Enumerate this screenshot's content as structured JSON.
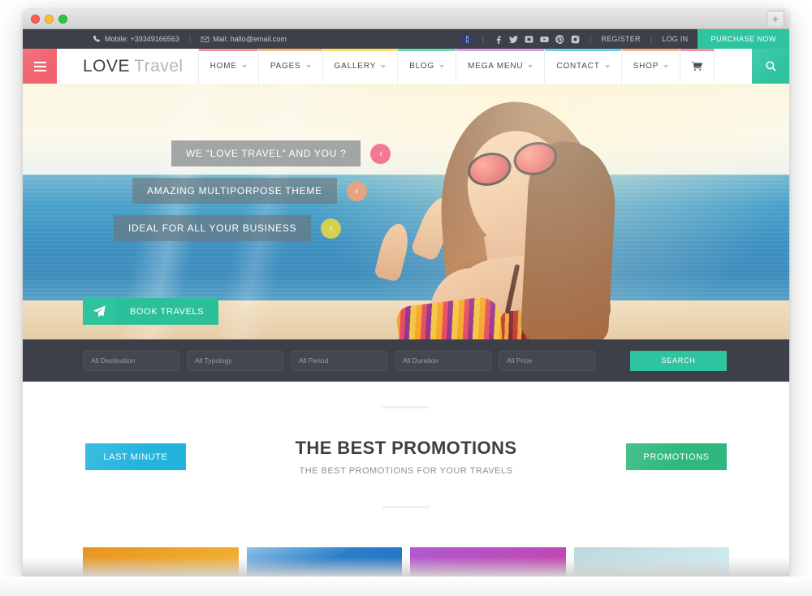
{
  "browser": {
    "tab_plus_label": "+"
  },
  "topbar": {
    "mobile_label": "Mobile: +39349166563",
    "mail_label": "Mail: hallo@email.com",
    "separator": "|",
    "flag_name": "uk-flag",
    "socials": [
      "facebook-icon",
      "twitter-icon",
      "vimeo-icon",
      "youtube-icon",
      "pinterest-icon",
      "instagram-icon"
    ],
    "register_label": "REGISTER",
    "login_label": "LOG IN",
    "purchase_label": "PURCHASE NOW",
    "bg_color": "#3e4049",
    "purchase_color": "#2ec4a0"
  },
  "header": {
    "burger_color": "#f2636f",
    "brand_first": "LOVE",
    "brand_second": "Travel",
    "search_color": "#2ec4a0",
    "nav": [
      {
        "label": "HOME",
        "caret": true,
        "bar": "#f4919d"
      },
      {
        "label": "PAGES",
        "caret": true,
        "bar": "#f5b878"
      },
      {
        "label": "GALLERY",
        "caret": true,
        "bar": "#f7e06a"
      },
      {
        "label": "BLOG",
        "caret": true,
        "bar": "#6fd3b6"
      },
      {
        "label": "MEGA MENU",
        "caret": true,
        "bar": "#d9a0e4"
      },
      {
        "label": "CONTACT",
        "caret": true,
        "bar": "#6fd0ea"
      },
      {
        "label": "SHOP",
        "caret": true,
        "bar": "#f6b185"
      },
      {
        "label": "",
        "caret": false,
        "bar": "#f4919d",
        "icon": "cart-icon"
      }
    ]
  },
  "hero": {
    "slides": [
      {
        "text": "WE \"LOVE TRAVEL\" AND YOU ?",
        "arrow_color": "#f2798f"
      },
      {
        "text": "AMAZING MULTIPORPOSE THEME",
        "arrow_color": "#e3a47f"
      },
      {
        "text": "IDEAL FOR ALL YOUR BUSINESS",
        "arrow_color": "#d5cf52"
      }
    ],
    "arrow_glyph": "‹",
    "book_button": {
      "label": "BOOK TRAVELS",
      "icon": "paper-plane-icon",
      "color": "#2ec4a0"
    }
  },
  "searchstrip": {
    "fields": [
      {
        "placeholder": "All Destination"
      },
      {
        "placeholder": "All Typology"
      },
      {
        "placeholder": "All Period"
      },
      {
        "placeholder": "All Duration"
      },
      {
        "placeholder": "All Price"
      }
    ],
    "button_label": "SEARCH",
    "button_color": "#2ec4a0",
    "bg_color": "#3e4049"
  },
  "promotions": {
    "left_button": {
      "label": "LAST MINUTE",
      "color": "#23b4dd"
    },
    "right_button": {
      "label": "PROMOTIONS",
      "color": "#2eb87f"
    },
    "title": "THE BEST PROMOTIONS",
    "subtitle": "THE BEST PROMOTIONS FOR YOUR TRAVELS"
  },
  "cards": [
    {
      "name": "card-orange",
      "color_top": "#e8941f",
      "color_bottom": "#f6b93b"
    },
    {
      "name": "card-blue",
      "color_top": "#6fa8dc",
      "color_bottom": "#1b6ec2"
    },
    {
      "name": "card-purple",
      "color_top": "#b05ad1",
      "color_bottom": "#c93fa8"
    },
    {
      "name": "card-cyan",
      "color_top": "#bcd8dc",
      "color_bottom": "#cfeef6"
    }
  ]
}
